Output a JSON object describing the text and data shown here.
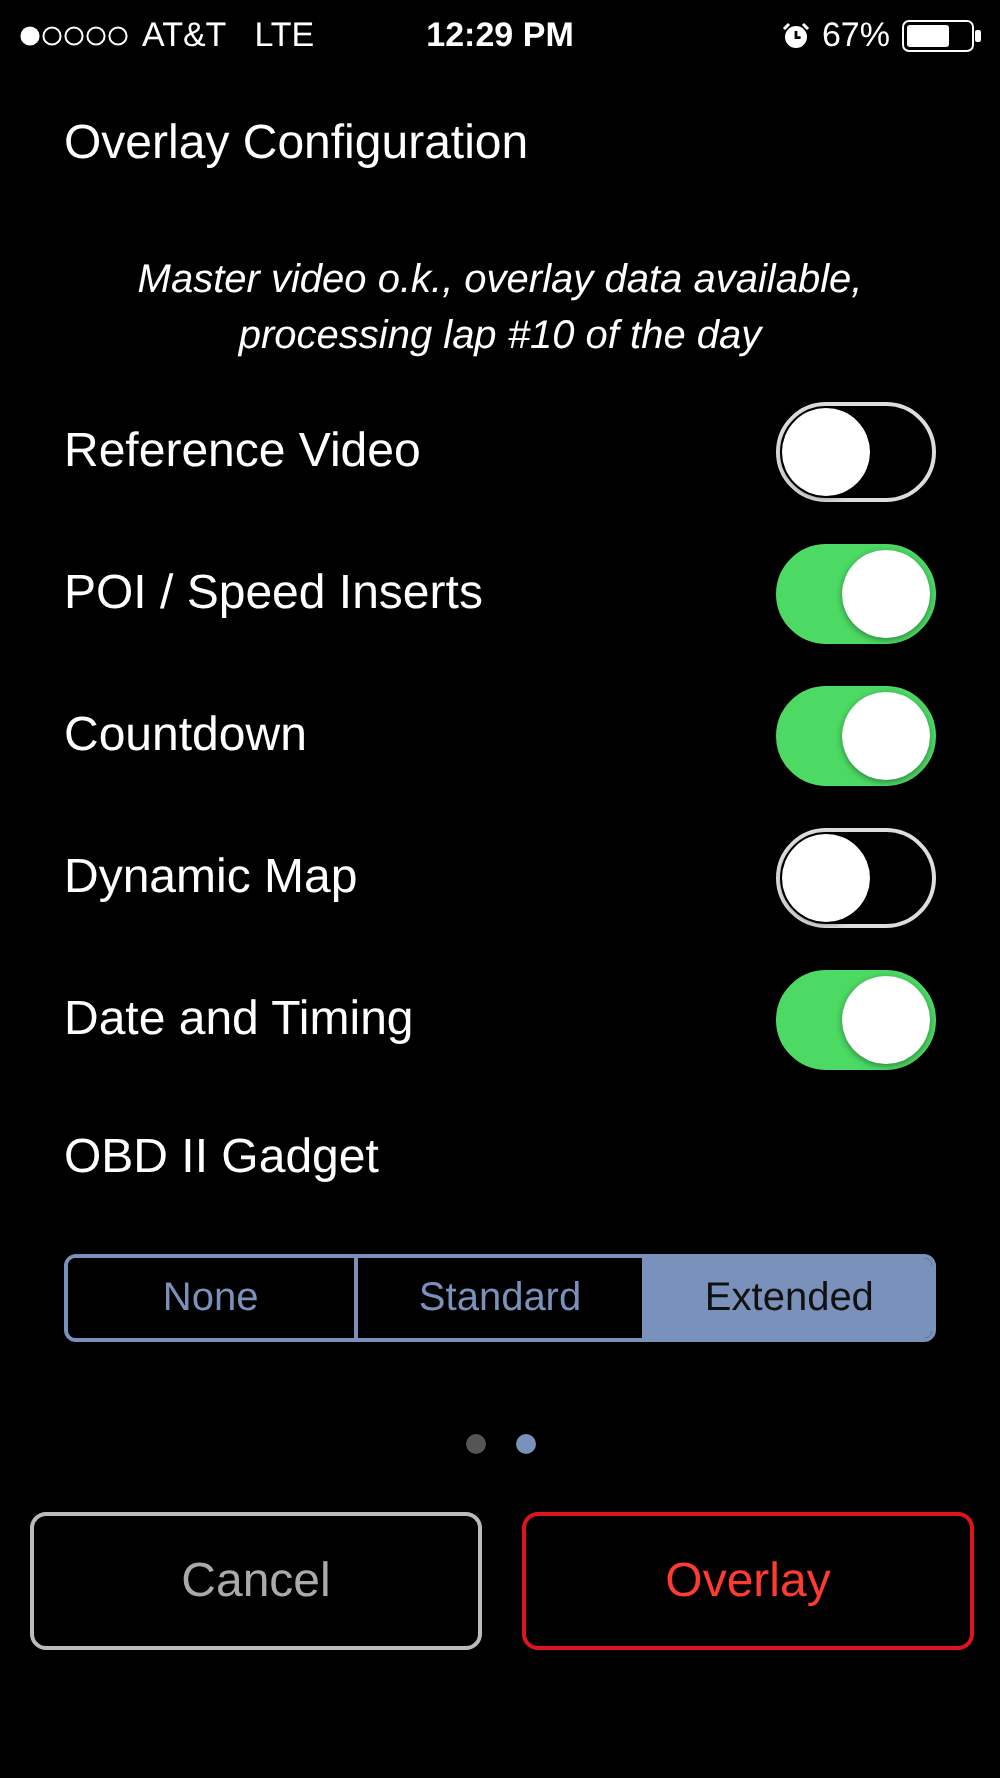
{
  "status_bar": {
    "carrier": "AT&T",
    "network": "LTE",
    "time": "12:29 PM",
    "battery": "67%"
  },
  "title": "Overlay Configuration",
  "status_message": "Master video o.k., overlay data available, processing lap #10 of the day",
  "options": [
    {
      "label": "Reference Video",
      "on": false
    },
    {
      "label": "POI / Speed Inserts",
      "on": true
    },
    {
      "label": "Countdown",
      "on": true
    },
    {
      "label": "Dynamic Map",
      "on": false
    },
    {
      "label": "Date and Timing",
      "on": true
    }
  ],
  "gadget": {
    "label": "OBD II Gadget",
    "segments": [
      {
        "label": "None",
        "selected": false
      },
      {
        "label": "Standard",
        "selected": false
      },
      {
        "label": "Extended",
        "selected": true
      }
    ]
  },
  "pages": [
    {
      "selected": false
    },
    {
      "selected": true
    }
  ],
  "buttons": [
    {
      "label": "Cancel",
      "kind": "cancel"
    },
    {
      "label": "Overlay",
      "kind": "primary"
    }
  ]
}
